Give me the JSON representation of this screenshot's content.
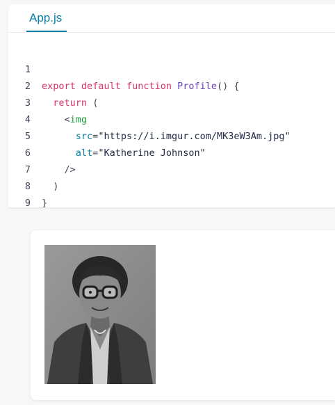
{
  "editor": {
    "tab_label": "App.js",
    "lines": [
      {
        "n": "1"
      },
      {
        "n": "2"
      },
      {
        "n": "3"
      },
      {
        "n": "4"
      },
      {
        "n": "5"
      },
      {
        "n": "6"
      },
      {
        "n": "7"
      },
      {
        "n": "8"
      },
      {
        "n": "9"
      }
    ],
    "tokens": {
      "l1_export": "export",
      "l1_default": "default",
      "l1_function": "function",
      "l1_name": "Profile",
      "l1_rest": "() {",
      "l2_return": "return",
      "l2_paren": "(",
      "l3_lt": "<",
      "l3_tag": "img",
      "l4_attr": "src",
      "l4_eq": "=",
      "l4_val": "\"https://i.imgur.com/MK3eW3Am.jpg\"",
      "l5_attr": "alt",
      "l5_eq": "=",
      "l5_val": "\"Katherine Johnson\"",
      "l6_close": "/>",
      "l7_paren": ")",
      "l8_brace": "}"
    }
  },
  "preview": {
    "image_alt": "Katherine Johnson"
  },
  "colors": {
    "accent": "#087ea4",
    "keyword": "#d6336c",
    "function": "#6f42c1",
    "tag": "#1a9d3b"
  }
}
